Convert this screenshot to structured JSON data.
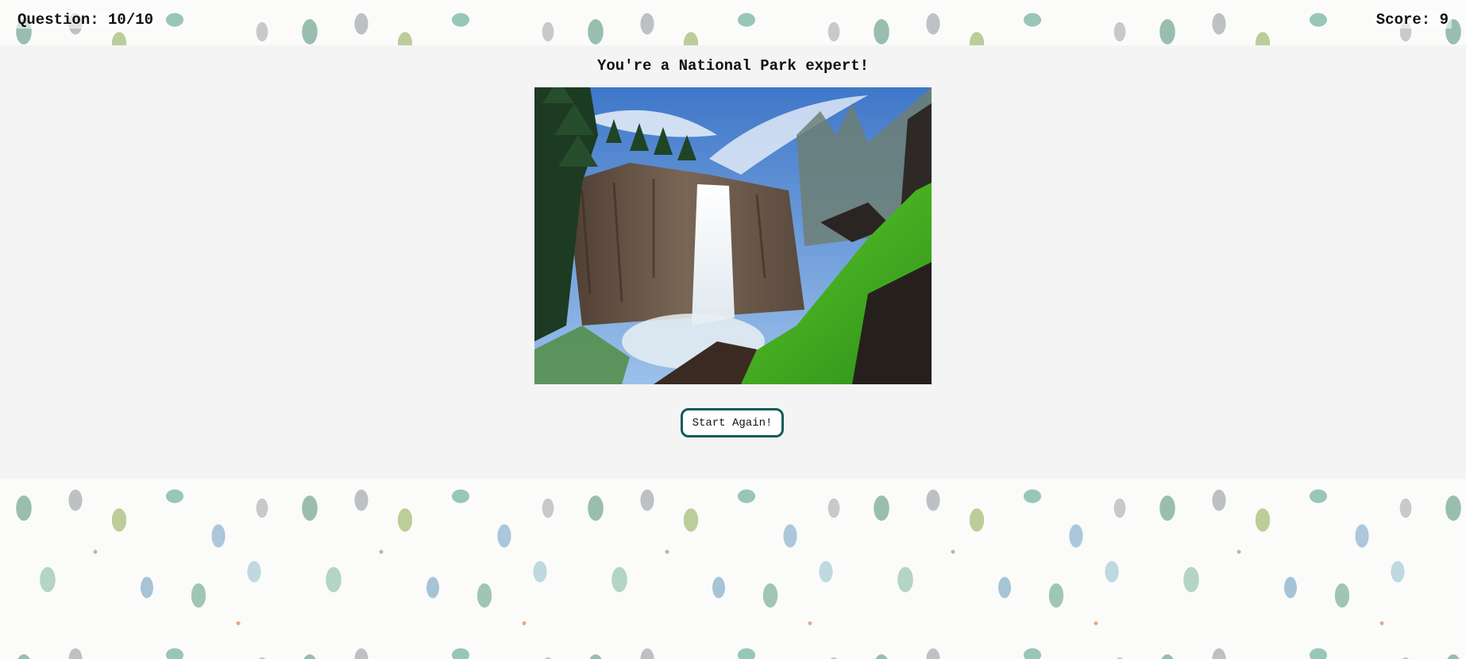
{
  "header": {
    "question_progress": "Question: 10/10",
    "score": "Score: 9"
  },
  "result": {
    "title": "You're a National Park expert!",
    "photo": "waterfall-photo",
    "restart_label": "Start Again!"
  },
  "colors": {
    "panel_background": "#f4f4f4",
    "button_border": "#0f5d5a",
    "text": "#111111"
  }
}
